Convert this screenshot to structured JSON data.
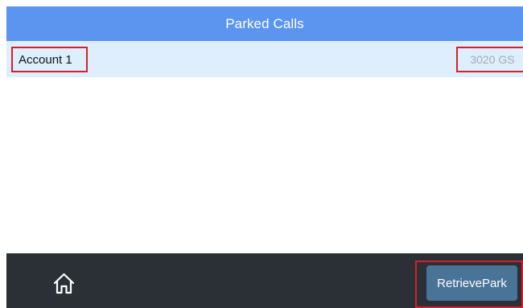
{
  "header": {
    "title": "Parked Calls"
  },
  "parked_calls": [
    {
      "account": "Account 1",
      "number": "3020 GS"
    }
  ],
  "footer": {
    "home_icon": "home-icon",
    "retrieve_button": "RetrievePark"
  },
  "colors": {
    "header_bg": "#5b95f0",
    "row_bg": "#deeefd",
    "footer_bg": "#2b2f36",
    "button_bg": "#4a7398",
    "highlight_border": "#d1222b"
  }
}
